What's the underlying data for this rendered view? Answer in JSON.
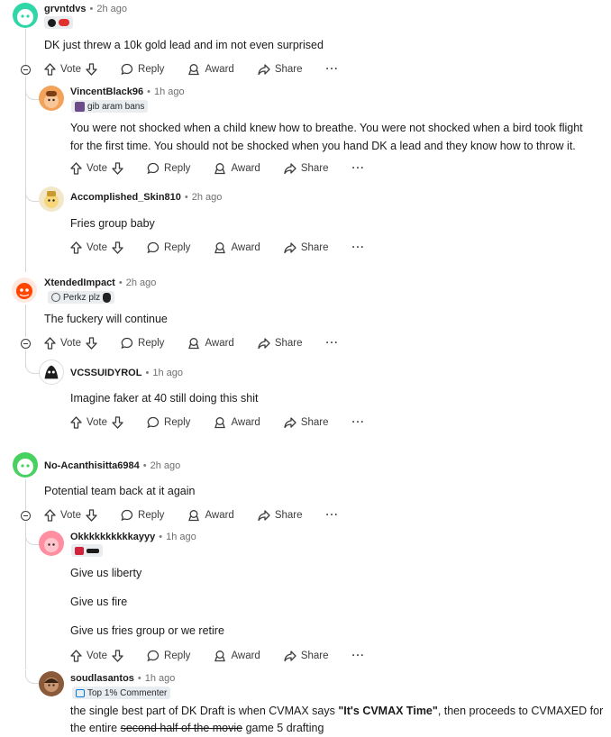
{
  "actions": {
    "vote": "Vote",
    "reply": "Reply",
    "award": "Award",
    "share": "Share",
    "more": "···"
  },
  "colors": {
    "accent": "#0079d3",
    "rail": "#d6d9db",
    "muted": "#6f6f6f"
  },
  "comments": [
    {
      "author": "grvntdvs",
      "time": "2h ago",
      "body": "DK just threw a 10k gold lead and im not even surprised",
      "avatar_color": "#2fd6a8"
    },
    {
      "author": "VincentBlack96",
      "time": "1h ago",
      "flair": "gib aram bans",
      "body": [
        "You were not shocked when a child knew how to breathe. You were not shocked when a bird took flight",
        "for the first time. You should not be shocked when you hand DK a lead and they know how to throw it."
      ],
      "avatar_color": "#f3a25a"
    },
    {
      "author": "Accomplished_Skin810",
      "time": "2h ago",
      "body": "Fries group baby",
      "avatar_color": "#f2e8c9"
    },
    {
      "author": "XtendedImpact",
      "time": "2h ago",
      "flair": "Perkz plz",
      "body": "The fuckery will continue",
      "avatar_color": "#ff4500"
    },
    {
      "author": "VCSSUIDYROL",
      "time": "1h ago",
      "body": "Imagine faker at 40 still doing this shit",
      "avatar_color": "#ffffff"
    },
    {
      "author": "No-Acanthisitta6984",
      "time": "2h ago",
      "body": "Potential team back at it again",
      "avatar_color": "#46d160"
    },
    {
      "author": "Okkkkkkkkkkayyy",
      "time": "1h ago",
      "body": [
        "Give us liberty",
        "Give us fire",
        "Give us fries group or we retire"
      ],
      "avatar_color": "#ff8fa0"
    },
    {
      "author": "soudlasantos",
      "time": "1h ago",
      "flair": "Top 1% Commenter",
      "body": {
        "pre": "the single best part of DK Draft is when CVMAX says ",
        "quote": "\"It's CVMAX Time\"",
        "post": ", then proceeds to CVMAXED for",
        "line2_pre": "the entire ",
        "struck": "second half of the movie",
        "line2_post": " game 5 drafting"
      },
      "avatar_color": "#8a5a3a"
    }
  ]
}
